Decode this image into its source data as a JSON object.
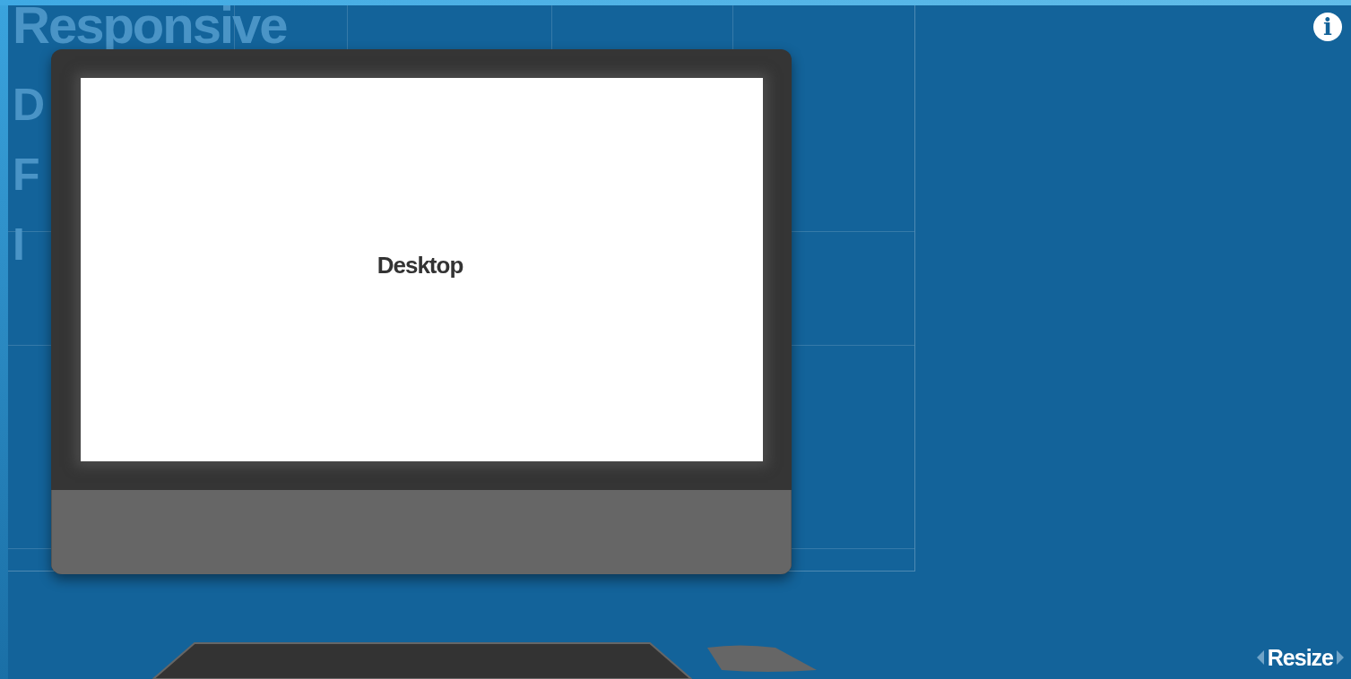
{
  "background_title": {
    "lines": [
      "Responsive",
      "D",
      "F",
      "I"
    ]
  },
  "device": {
    "kind": "desktop",
    "screen_label": "Desktop"
  },
  "info_button": {
    "label": "i"
  },
  "resize_control": {
    "label": "Resize"
  }
}
